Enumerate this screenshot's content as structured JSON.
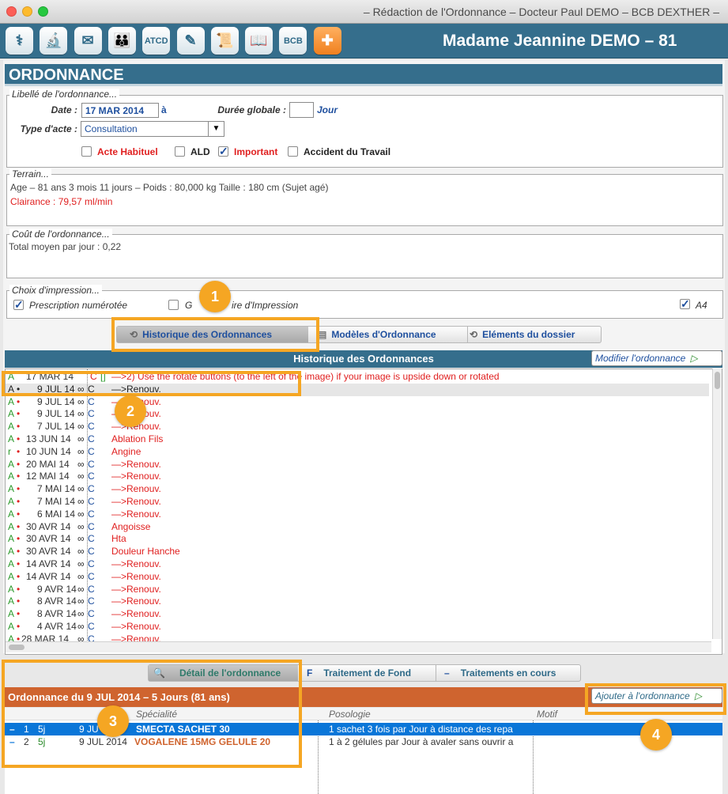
{
  "window": {
    "title": "– Rédaction de l'Ordonnance – Docteur Paul DEMO – BCB DEXTHER –"
  },
  "colors": {
    "toolbar": "#356e8c",
    "annotation": "#f5a623",
    "detail_header": "#cf642f",
    "selection": "#0a76d8",
    "link": "#1e4f9e",
    "red": "#e02020"
  },
  "toolbar": {
    "icons": [
      {
        "name": "stethoscope-icon",
        "glyph": "⚕"
      },
      {
        "name": "microscope-icon",
        "glyph": "🔬"
      },
      {
        "name": "envelope-icon",
        "glyph": "✉"
      },
      {
        "name": "family-icon",
        "glyph": "👪"
      },
      {
        "name": "atcd-icon",
        "glyph": "ATCD"
      },
      {
        "name": "edit-letter-icon",
        "glyph": "✎"
      },
      {
        "name": "certificate-icon",
        "glyph": "📜"
      },
      {
        "name": "book-icon",
        "glyph": "📖"
      },
      {
        "name": "bcb-icon",
        "glyph": "BCB"
      },
      {
        "name": "medicine-icon",
        "glyph": "✚"
      }
    ],
    "patient": "Madame Jeannine DEMO – 81"
  },
  "ordonnance": {
    "title": "ORDONNANCE",
    "libelle": {
      "legend": "Libellé de l'ordonnance...",
      "date_label": "Date :",
      "date_value": "17 MAR 2014",
      "date_suffix": "à",
      "duree_label": "Durée globale :",
      "duree_value": "",
      "duree_unit": "Jour",
      "type_label": "Type d'acte :",
      "type_value": "Consultation",
      "checks": [
        {
          "label": "Acte Habituel",
          "checked": false,
          "color": "red"
        },
        {
          "label": "ALD",
          "checked": false,
          "color": "dark"
        },
        {
          "label": "Important",
          "checked": true,
          "color": "red"
        },
        {
          "label": "Accident du Travail",
          "checked": false,
          "color": "dark"
        }
      ]
    },
    "terrain": {
      "legend": "Terrain...",
      "line1": "Age – 81 ans 3 mois 11 jours  –  Poids : 80,000 kg Taille : 180 cm (Sujet agé)",
      "line2": "Clairance : 79,57 ml/min"
    },
    "cout": {
      "legend": "Coût de l'ordonnance...",
      "line1": "Total moyen par jour : 0,22"
    },
    "impression": {
      "legend": "Choix d'impression...",
      "prescription": "Prescription numérotée",
      "gest_a": "G",
      "gest_b": "ire d'Impression",
      "a4": "A4"
    }
  },
  "tabs_top": [
    {
      "label": "Historique des Ordonnances",
      "selected": true
    },
    {
      "label": "Modèles d'Ordonnance",
      "selected": false
    },
    {
      "label": "Eléments du dossier",
      "selected": false
    }
  ],
  "historique": {
    "title": "Historique des Ordonnances",
    "modify": "Modifier l'ordonnance",
    "rows": [
      {
        "a": "A",
        "dot": "",
        "date": "17 MAR 14",
        "inf": "",
        "c": "C",
        "flag": "[]",
        "text": "—>2) Use the rotate buttons (to the left of the image) if your image is upside down or rotated",
        "color": "red"
      },
      {
        "a": "A",
        "dot": "•",
        "date": "9 JUL 14",
        "inf": "∞",
        "c": "C",
        "flag": "",
        "text": "—>Renouv.",
        "color": "dark"
      },
      {
        "a": "A",
        "dot": "•",
        "date": "9 JUL 14",
        "inf": "∞",
        "c": "C",
        "flag": "",
        "text": "—>Renouv.",
        "color": "red"
      },
      {
        "a": "A",
        "dot": "•",
        "date": "9 JUL 14",
        "inf": "∞",
        "c": "C",
        "flag": "",
        "text": "—>Renouv.",
        "color": "red"
      },
      {
        "a": "A",
        "dot": "•",
        "date": "7 JUL 14",
        "inf": "∞",
        "c": "C",
        "flag": "",
        "text": "—>Renouv.",
        "color": "red"
      },
      {
        "a": "A",
        "dot": "•",
        "date": "13 JUN 14",
        "inf": "∞",
        "c": "C",
        "flag": "",
        "text": "Ablation Fils",
        "color": "red"
      },
      {
        "a": "r",
        "dot": "•",
        "date": "10 JUN 14",
        "inf": "∞",
        "c": "C",
        "flag": "",
        "text": "Angine",
        "color": "red"
      },
      {
        "a": "A",
        "dot": "•",
        "date": "20 MAI 14",
        "inf": "∞",
        "c": "C",
        "flag": "",
        "text": "—>Renouv.",
        "color": "red"
      },
      {
        "a": "A",
        "dot": "•",
        "date": "12 MAI 14",
        "inf": "∞",
        "c": "C",
        "flag": "",
        "text": "—>Renouv.",
        "color": "red"
      },
      {
        "a": "A",
        "dot": "•",
        "date": "7 MAI 14",
        "inf": "∞",
        "c": "C",
        "flag": "",
        "text": "—>Renouv.",
        "color": "red"
      },
      {
        "a": "A",
        "dot": "•",
        "date": "7 MAI 14",
        "inf": "∞",
        "c": "C",
        "flag": "",
        "text": "—>Renouv.",
        "color": "red"
      },
      {
        "a": "A",
        "dot": "•",
        "date": "6 MAI 14",
        "inf": "∞",
        "c": "C",
        "flag": "",
        "text": "—>Renouv.",
        "color": "red"
      },
      {
        "a": "A",
        "dot": "•",
        "date": "30 AVR 14",
        "inf": "∞",
        "c": "C",
        "flag": "",
        "text": "Angoisse",
        "color": "red"
      },
      {
        "a": "A",
        "dot": "•",
        "date": "30 AVR 14",
        "inf": "∞",
        "c": "C",
        "flag": "",
        "text": "Hta",
        "color": "red"
      },
      {
        "a": "A",
        "dot": "•",
        "date": "30 AVR 14",
        "inf": "∞",
        "c": "C",
        "flag": "",
        "text": "Douleur Hanche",
        "color": "red"
      },
      {
        "a": "A",
        "dot": "•",
        "date": "14 AVR 14",
        "inf": "∞",
        "c": "C",
        "flag": "",
        "text": "—>Renouv.",
        "color": "red"
      },
      {
        "a": "A",
        "dot": "•",
        "date": "14 AVR 14",
        "inf": "∞",
        "c": "C",
        "flag": "",
        "text": "—>Renouv.",
        "color": "red"
      },
      {
        "a": "A",
        "dot": "•",
        "date": "9 AVR 14",
        "inf": "∞",
        "c": "C",
        "flag": "",
        "text": "—>Renouv.",
        "color": "red"
      },
      {
        "a": "A",
        "dot": "•",
        "date": "8 AVR 14",
        "inf": "∞",
        "c": "C",
        "flag": "",
        "text": "—>Renouv.",
        "color": "red"
      },
      {
        "a": "A",
        "dot": "•",
        "date": "8 AVR 14",
        "inf": "∞",
        "c": "C",
        "flag": "",
        "text": "—>Renouv.",
        "color": "red"
      },
      {
        "a": "A",
        "dot": "•",
        "date": "4 AVR 14",
        "inf": "∞",
        "c": "C",
        "flag": "",
        "text": "—>Renouv.",
        "color": "red"
      },
      {
        "a": "A",
        "dot": "•",
        "date": "28 MAR 14",
        "inf": "∞",
        "c": "C",
        "flag": "",
        "text": "—>Renouv.",
        "color": "red"
      }
    ]
  },
  "tabs_bottom": [
    {
      "label": "Détail de l'ordonnance",
      "prefix": "🔍",
      "selected": true
    },
    {
      "label": "Traitement de Fond",
      "prefix": "F",
      "selected": false
    },
    {
      "label": "Traitements en cours",
      "prefix": "–",
      "selected": false
    }
  ],
  "detail": {
    "title": "Ordonnance du 9 JUL 2014 – 5 Jours (81 ans)",
    "add": "Ajouter à l'ordonnance",
    "col_specialite": "Spécialité",
    "col_posologie": "Posologie",
    "col_motif": "Motif",
    "rows": [
      {
        "num": "1",
        "dur": "5j",
        "date": "9 JU",
        "name": "SMECTA SACHET 30",
        "poso": "1 sachet 3 fois par Jour à distance des repa",
        "selected": true
      },
      {
        "num": "2",
        "dur": "5j",
        "date": "9 JUL 2014",
        "name": "VOGALENE 15MG GELULE 20",
        "poso": "1 à 2 gélules par Jour à avaler sans ouvrir a",
        "selected": false
      }
    ]
  },
  "annotations": [
    "1",
    "2",
    "3",
    "4"
  ]
}
